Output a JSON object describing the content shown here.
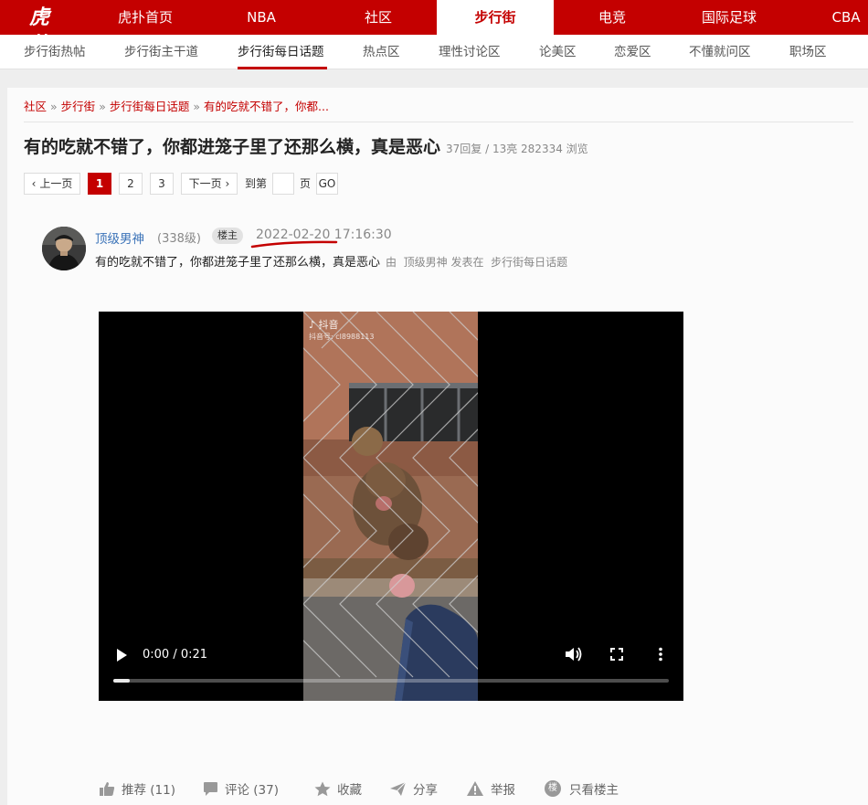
{
  "topnav": {
    "logo": "虎扑",
    "items": [
      "虎扑首页",
      "NBA",
      "社区",
      "步行街",
      "电竞",
      "国际足球",
      "CBA"
    ],
    "active_index": 3
  },
  "subnav": {
    "items": [
      "步行街热帖",
      "步行街主干道",
      "步行街每日话题",
      "热点区",
      "理性讨论区",
      "论美区",
      "恋爱区",
      "不懂就问区",
      "职场区"
    ],
    "active_index": 2
  },
  "breadcrumb": [
    "社区",
    "步行街",
    "步行街每日话题",
    "有的吃就不错了，你都..."
  ],
  "breadcrumb_sep": "»",
  "post": {
    "title": "有的吃就不错了，你都进笼子里了还那么横，真是恶心",
    "meta": "37回复 / 13亮 282334 浏览",
    "author": "顶级男神",
    "level": "(338级)",
    "badge": "楼主",
    "time": "2022-02-20 17:16:30",
    "body": "有的吃就不错了，你都进笼子里了还那么横，真是恶心",
    "by_prefix": "由",
    "by_author": "顶级男神",
    "by_mid": "发表在",
    "by_board": "步行街每日话题"
  },
  "pager": {
    "prev": "上一页",
    "pages": [
      "1",
      "2",
      "3"
    ],
    "current": "1",
    "next": "下一页",
    "goto_label": "到第",
    "page_label": "页",
    "go": "GO"
  },
  "video": {
    "watermark": "抖音",
    "watermark_id": "抖音号: cl8988113",
    "time": "0:00 / 0:21",
    "progress": 0.03
  },
  "actions": {
    "recommend": "推荐 (11)",
    "comment": "评论 (37)",
    "favorite": "收藏",
    "share": "分享",
    "report": "举报",
    "only_host": "只看楼主",
    "only_host_icon_char": "楼"
  },
  "colors": {
    "brand_red": "#c40000",
    "link_blue": "#3b73b8"
  }
}
